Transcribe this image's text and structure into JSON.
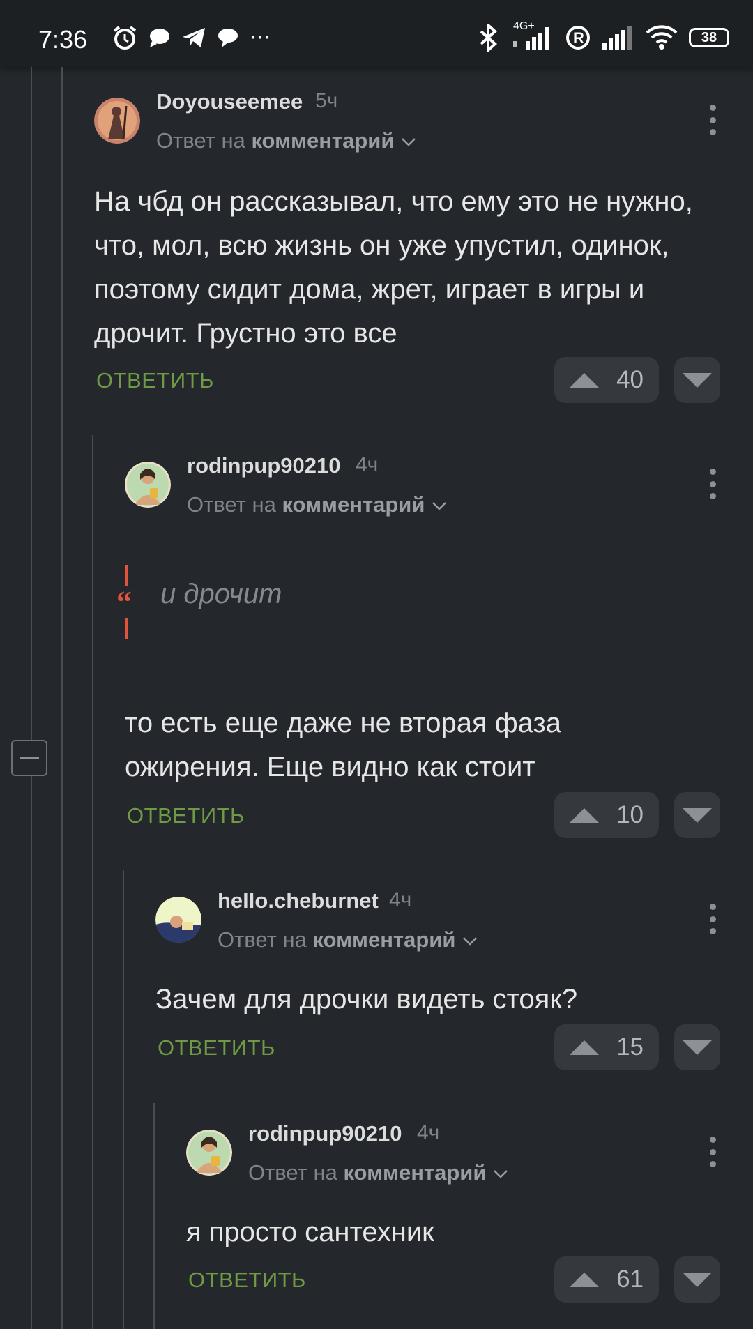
{
  "status_bar": {
    "time": "7:36",
    "network": "4G+",
    "battery": "38",
    "icons_left": [
      "alarm-icon",
      "chat-bubble-icon",
      "telegram-icon",
      "message-icon",
      "more-dots-icon"
    ],
    "icons_right": [
      "bluetooth-icon",
      "signal-icon",
      "registered-icon",
      "signal-icon",
      "wifi-icon",
      "battery-icon"
    ]
  },
  "colors": {
    "background": "#24272b",
    "reply_green": "#6e9a46",
    "quote_red": "#e0533c",
    "vote_bg": "#35383c"
  },
  "comments": [
    {
      "author": "Doyouseemee",
      "time": "5ч",
      "reply_prefix": "Ответ на",
      "reply_target": "комментарий",
      "text": "На чбд он рассказывал, что ему это не нужно, что, мол, всю жизнь он уже упустил, одинок, поэтому сидит дома, жрет, играет в игры и дрочит. Грустно это все",
      "reply_label": "ОТВЕТИТЬ",
      "votes": "40"
    },
    {
      "author": "rodinpup90210",
      "time": "4ч",
      "reply_prefix": "Ответ на",
      "reply_target": "комментарий",
      "quote": "и дрочит",
      "text": "то есть еще даже не вторая фаза ожирения. Еще видно как стоит",
      "reply_label": "ОТВЕТИТЬ",
      "votes": "10"
    },
    {
      "author": "hello.cheburnet",
      "time": "4ч",
      "reply_prefix": "Ответ на",
      "reply_target": "комментарий",
      "text": "Зачем для дрочки видеть стояк?",
      "reply_label": "ОТВЕТИТЬ",
      "votes": "15"
    },
    {
      "author": "rodinpup90210",
      "time": "4ч",
      "reply_prefix": "Ответ на",
      "reply_target": "комментарий",
      "text": "я просто сантехник",
      "reply_label": "ОТВЕТИТЬ",
      "votes": "61"
    }
  ]
}
